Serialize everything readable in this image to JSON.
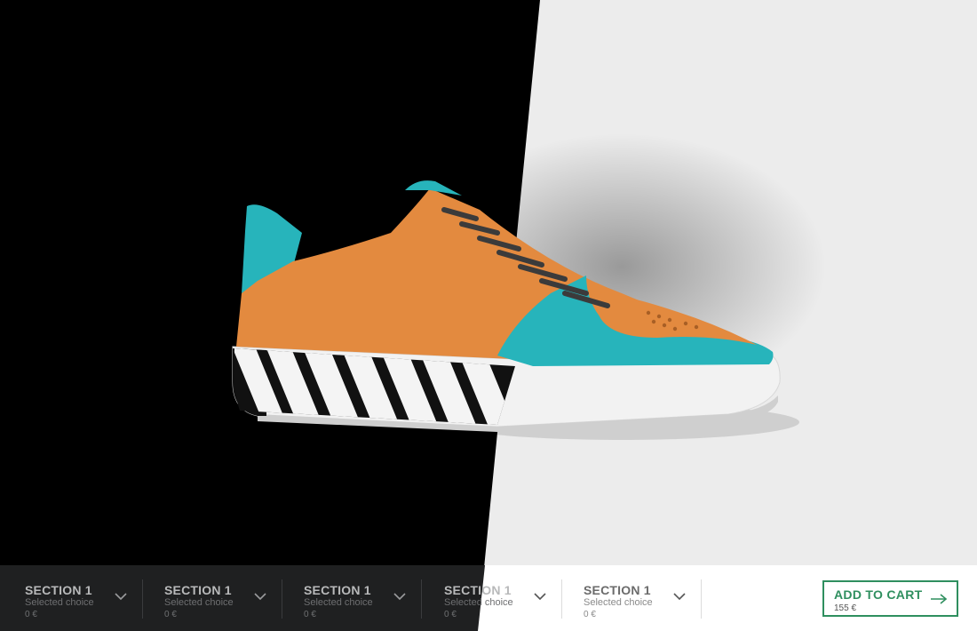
{
  "product": {
    "image_alt": "sneaker-preview",
    "colors": {
      "upper": "#e38a3f",
      "accent": "#27b4bb",
      "laces": "#3b3b3b",
      "sole": "#f2f2f2",
      "stripe_dark": "#111111"
    }
  },
  "configurator": {
    "sections": [
      {
        "title": "SECTION 1",
        "choice": "Selected choice",
        "price": "0 €"
      },
      {
        "title": "SECTION 1",
        "choice": "Selected choice",
        "price": "0 €"
      },
      {
        "title": "SECTION 1",
        "choice": "Selected choice",
        "price": "0 €"
      },
      {
        "title": "SECTION 1",
        "choice": "Selected choice",
        "price": "0 €"
      },
      {
        "title": "SECTION 1",
        "choice": "Selected choice",
        "price": "0 €"
      }
    ],
    "cart": {
      "label": "ADD TO CART",
      "total": "155 €",
      "accent": "#2f8f5f"
    }
  }
}
